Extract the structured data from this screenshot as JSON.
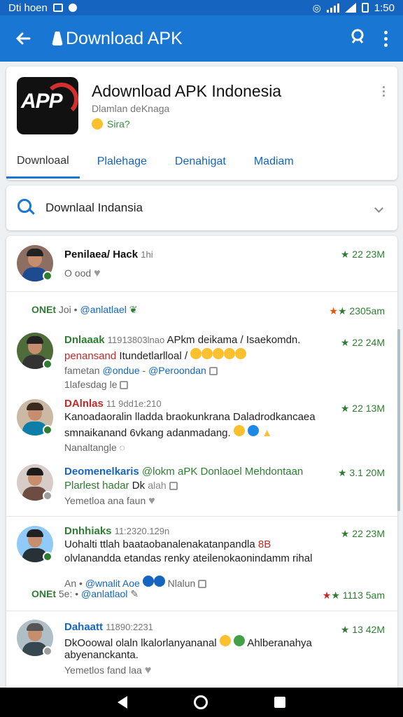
{
  "status_bar": {
    "left_text": "Dti hoen",
    "time": "1:50"
  },
  "app_bar": {
    "title": "Download APK"
  },
  "app_card": {
    "name": "Adownload APK Indonesia",
    "subtitle": "Dlamlan deKnaga",
    "rating_text": "Sira?",
    "tabs": [
      "Downloaal",
      "Plalehage",
      "Denahigat",
      "Madiam"
    ]
  },
  "search": {
    "text": "Downlaal Indansia"
  },
  "feed": {
    "posts": [
      {
        "user": "Penilaea/ Hack",
        "meta": "1hi",
        "status": "O ood",
        "score": "22 23M"
      },
      {
        "tag": "ONEt",
        "meta": "Joi",
        "handle": "@anlatlael",
        "score": "2305am"
      },
      {
        "user": "Dnlaaak",
        "meta": "11913803lnao",
        "text1": "APkm deikama / Isaekomdn.",
        "text2a": "penansand",
        "text2b": "Itundetlarlloal /",
        "handle_line": "fametan",
        "handle_mid": "@ondue",
        "handle_end": "@Peroondan",
        "status": "1lafesdag le",
        "score": "22 24M"
      },
      {
        "user": "DAlnlas",
        "meta": "11 9dd1e:210",
        "text1": "Kanoadaoralin lladda braokunkrana Daladrodkancaea",
        "text2": "smnaikanand 6vkang adanmadang.",
        "status": "Nanaltangle",
        "score": "22 13M"
      },
      {
        "user": "Deomenelkaris",
        "meta": "@lokm aPK Donlaoel Mehdontaan",
        "text2a": "Plarlest hadar",
        "text2b": "Dk",
        "text2c": "alah",
        "status": "Yemetloa ana faun",
        "score": "3.1 20M"
      },
      {
        "user": "Dnhhiaks",
        "meta": "11:2320.129n",
        "text1": "Uohalti ttlah baataobanalenakatanpandla",
        "text1b": "8B",
        "text2": "olvlanandda etandas renky ateilenokaonindamm rihal",
        "handle_pre": "An",
        "handle": "@wnalit Aoe",
        "mid": "Nlalun",
        "score": "22 23M"
      },
      {
        "tag": "ONEt",
        "meta": "5e:",
        "handle": "@anlatlaol",
        "score": "1113 5am"
      },
      {
        "user": "Dahaatt",
        "meta": "11890:2231",
        "text1": "DkOoowal olaln lkalorlanyananal",
        "text1b": "Ahlberanahya",
        "text2": "abyenanckanta.",
        "status": "Yemetlos fand laa",
        "score": "13 42M"
      }
    ]
  },
  "colors": {
    "primary": "#1976d2",
    "status": "#1565c0",
    "accent_green": "#2e7d32"
  }
}
